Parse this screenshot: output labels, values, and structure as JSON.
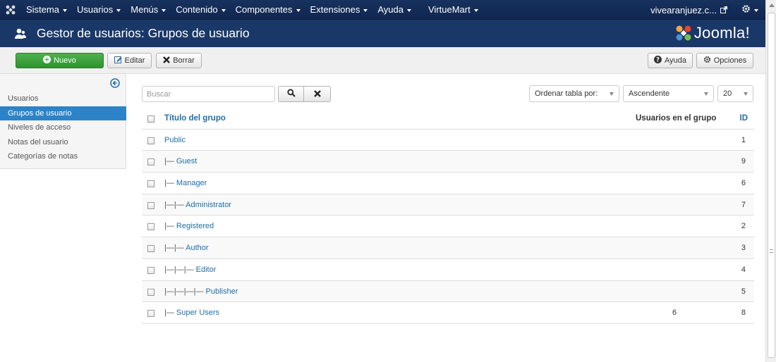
{
  "navbar": {
    "items": [
      {
        "label": "Sistema",
        "has_caret": true
      },
      {
        "label": "Usuarios",
        "has_caret": true
      },
      {
        "label": "Menús",
        "has_caret": true
      },
      {
        "label": "Contenido",
        "has_caret": true
      },
      {
        "label": "Componentes",
        "has_caret": true
      },
      {
        "label": "Extensiones",
        "has_caret": true
      },
      {
        "label": "Ayuda",
        "has_caret": true
      },
      {
        "label": "VirtueMart",
        "has_caret": true
      }
    ],
    "site_label": "vivearanjuez.c..."
  },
  "header": {
    "title": "Gestor de usuarios: Grupos de usuario",
    "brand": "Joomla!"
  },
  "toolbar": {
    "new_label": "Nuevo",
    "edit_label": "Editar",
    "delete_label": "Borrar",
    "help_label": "Ayuda",
    "options_label": "Opciones"
  },
  "sidebar": {
    "items": [
      {
        "label": "Usuarios",
        "active": false
      },
      {
        "label": "Grupos de usuario",
        "active": true
      },
      {
        "label": "Niveles de acceso",
        "active": false
      },
      {
        "label": "Notas del usuario",
        "active": false
      },
      {
        "label": "Categorías de notas",
        "active": false
      }
    ]
  },
  "filters": {
    "search_placeholder": "Buscar",
    "order_label": "Ordenar tabla por:",
    "direction_label": "Ascendente",
    "limit_label": "20"
  },
  "table": {
    "headers": {
      "title": "Título del grupo",
      "users": "Usuarios en el grupo",
      "id": "ID"
    },
    "rows": [
      {
        "prefix": "",
        "name": "Public",
        "users": "",
        "id": "1"
      },
      {
        "prefix": "|— ",
        "name": "Guest",
        "users": "",
        "id": "9"
      },
      {
        "prefix": "|— ",
        "name": "Manager",
        "users": "",
        "id": "6"
      },
      {
        "prefix": "|—|— ",
        "name": "Administrator",
        "users": "",
        "id": "7"
      },
      {
        "prefix": "|— ",
        "name": "Registered",
        "users": "",
        "id": "2"
      },
      {
        "prefix": "|—|— ",
        "name": "Author",
        "users": "",
        "id": "3"
      },
      {
        "prefix": "|—|—|— ",
        "name": "Editor",
        "users": "",
        "id": "4"
      },
      {
        "prefix": "|—|—|—|— ",
        "name": "Publisher",
        "users": "",
        "id": "5"
      },
      {
        "prefix": "|— ",
        "name": "Super Users",
        "users": "6",
        "id": "8"
      }
    ]
  },
  "colors": {
    "navbar_bg": "#17325e",
    "header_bg": "#1a3867",
    "new_button": "#3ea33e",
    "active_sidebar": "#2d83c7",
    "link": "#1f6ea8"
  }
}
